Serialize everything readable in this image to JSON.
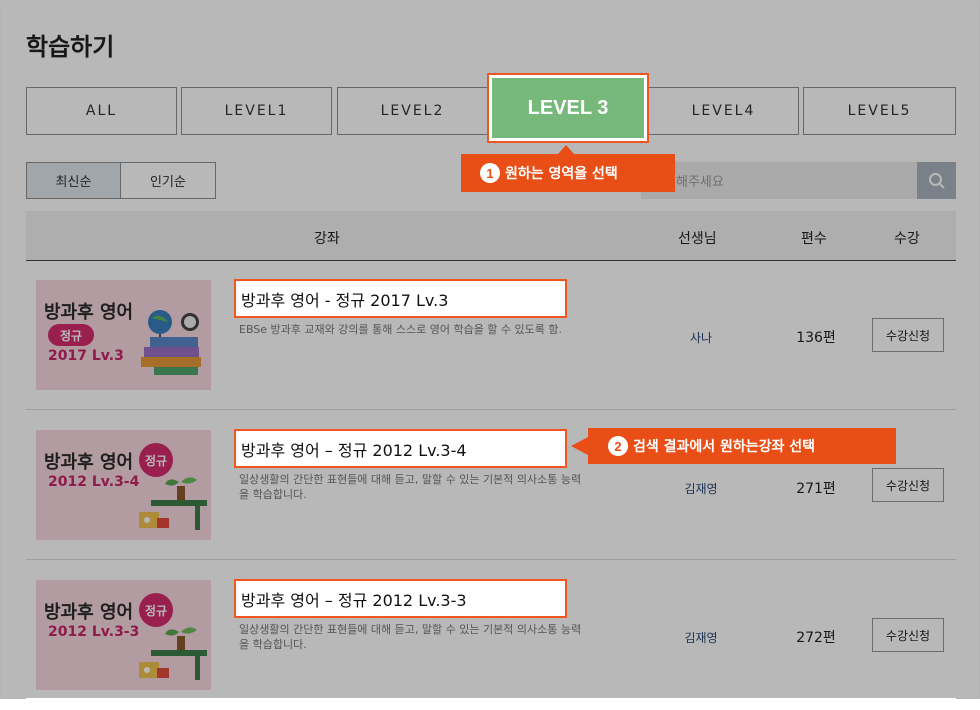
{
  "page": {
    "title": "학습하기"
  },
  "level_tabs": [
    {
      "label": "ALL"
    },
    {
      "label": "LEVEL1"
    },
    {
      "label": "LEVEL2"
    },
    {
      "label": "LEVEL 3"
    },
    {
      "label": "LEVEL4"
    },
    {
      "label": "LEVEL5"
    }
  ],
  "sort": {
    "latest": "최신순",
    "popular": "인기순"
  },
  "search": {
    "placeholder": "해주세요",
    "icon": "search-icon"
  },
  "table": {
    "headers": {
      "course": "강좌",
      "teacher": "선생님",
      "count": "편수",
      "enroll": "수강"
    }
  },
  "courses": [
    {
      "title": "방과후 영어 - 정규 2017 Lv.3",
      "desc": "EBSe 방과후 교재와 강의를 통해 스스로 영어 학습을 할 수 있도록 함.",
      "teacher": "사나",
      "count": "136편",
      "enroll": "수강신청",
      "thumb": {
        "line1": "방과후 영어",
        "badge": "정규",
        "line3": "2017 Lv.3"
      }
    },
    {
      "title": "방과후 영어 – 정규 2012 Lv.3-4",
      "desc": "일상생활의 간단한 표현들에 대해 듣고, 말할 수 있는 기본적 의사소통 능력을 학습합니다.",
      "teacher": "김재영",
      "count": "271편",
      "enroll": "수강신청",
      "thumb": {
        "line1": "방과후 영어",
        "badge": "정규",
        "line3": "2012 Lv.3-4"
      }
    },
    {
      "title": "방과후 영어 – 정규 2012 Lv.3-3",
      "desc": "일상생활의 간단한 표현들에 대해 듣고, 말할 수 있는 기본적 의사소통 능력을 학습합니다.",
      "teacher": "김재영",
      "count": "272편",
      "enroll": "수강신청",
      "thumb": {
        "line1": "방과후 영어",
        "badge": "정규",
        "line3": "2012 Lv.3-3"
      }
    }
  ],
  "callouts": [
    {
      "num": "1",
      "text": "원하는 영역을 선택"
    },
    {
      "num": "2",
      "text": "검색 결과에서 원하는강좌 선택"
    }
  ],
  "colors": {
    "accent": "#e84e16",
    "level_active": "#76b97a",
    "badge": "#d52b6d"
  }
}
